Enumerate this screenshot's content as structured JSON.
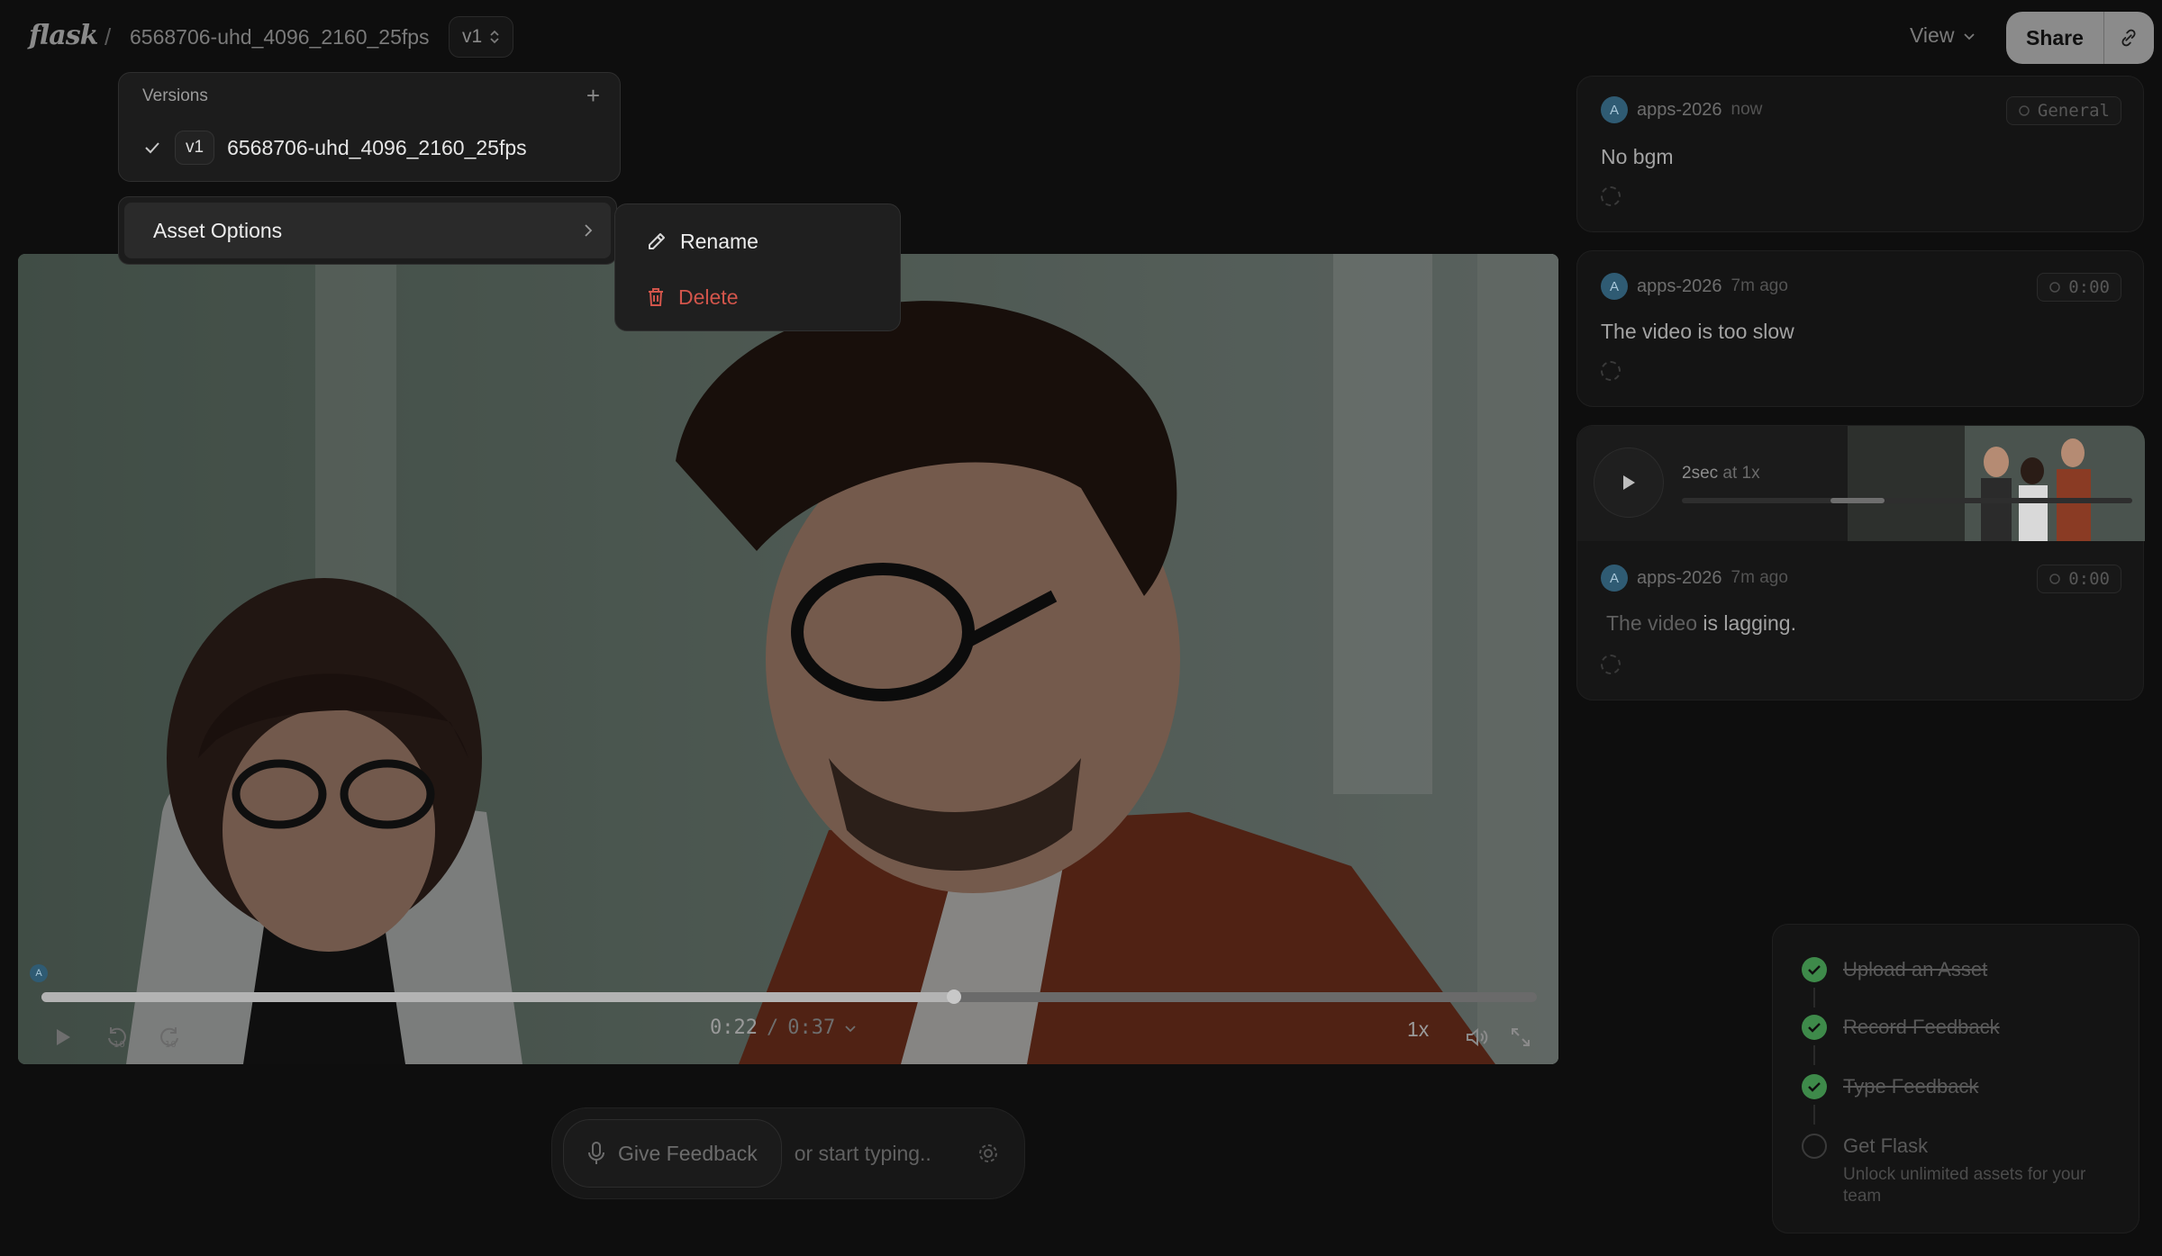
{
  "header": {
    "logo": "flask",
    "breadcrumb_separator": "/",
    "asset_name": "6568706-uhd_4096_2160_25fps",
    "version_label": "v1",
    "view_label": "View",
    "share_label": "Share"
  },
  "versions_menu": {
    "title": "Versions",
    "add_symbol": "+",
    "items": [
      {
        "badge": "v1",
        "name": "6568706-uhd_4096_2160_25fps",
        "selected": true
      }
    ]
  },
  "asset_options": {
    "label": "Asset Options",
    "submenu": {
      "rename": "Rename",
      "delete": "Delete"
    }
  },
  "player": {
    "progress": 0.61,
    "current_time": "0:22",
    "separator": "/",
    "duration": "0:37",
    "speed": "1x",
    "skip_back_seconds": "10",
    "skip_forward_seconds": "10",
    "marker_initial": "A"
  },
  "feedback_bar": {
    "give_feedback": "Give Feedback",
    "typing_hint": "or start typing.."
  },
  "comments": [
    {
      "initial": "A",
      "user": "apps-2026",
      "time": "now",
      "tag": "General",
      "text": "No bgm"
    },
    {
      "initial": "A",
      "user": "apps-2026",
      "time": "7m ago",
      "tag": "0:00",
      "text": "The video is too slow"
    },
    {
      "initial": "A",
      "user": "apps-2026",
      "time": "7m ago",
      "tag": "0:00",
      "text_muted": "The video",
      "text_main": " is lagging.",
      "audio": {
        "duration": "2sec",
        "speed_suffix": " at 1x",
        "progress_start": 0.33,
        "progress_end": 0.45
      }
    }
  ],
  "onboarding": {
    "steps": [
      {
        "label": "Upload an Asset",
        "done": true
      },
      {
        "label": "Record Feedback",
        "done": true
      },
      {
        "label": "Type Feedback",
        "done": true
      },
      {
        "label": "Get Flask",
        "done": false,
        "sub": "Unlock unlimited assets for your team"
      }
    ]
  },
  "colors": {
    "background": "#0e0e0e",
    "accent_green": "#3e8a4a",
    "danger": "#d2554b",
    "avatar_blue": "#2f5b73"
  }
}
